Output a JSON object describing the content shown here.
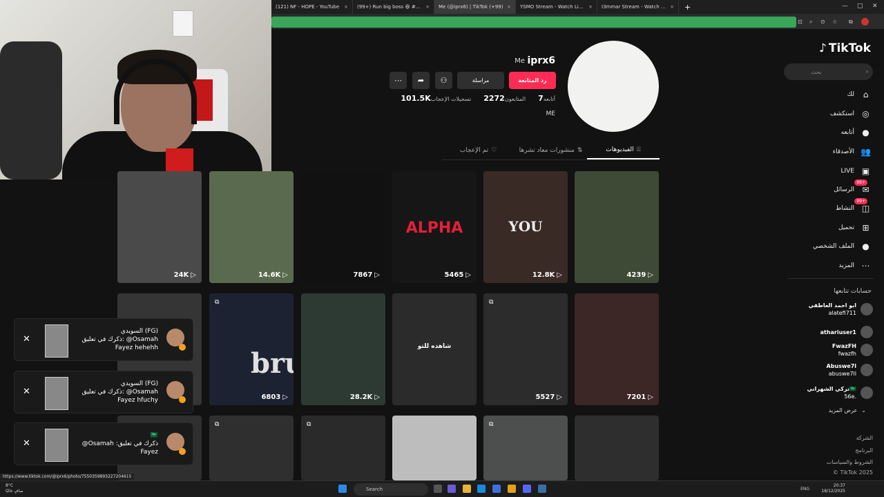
{
  "browser": {
    "tabs": [
      {
        "label": "(121) NF - HOPE - YouTube",
        "active": false
      },
      {
        "label": "(99+) Run big boss 😆 #bigboss",
        "active": false
      },
      {
        "label": "Me (@iprx6) | TikTok (+99)",
        "active": true
      },
      {
        "label": "YSMO Stream - Watch Live on",
        "active": false
      },
      {
        "label": "I3mmar Stream - Watch Live on",
        "active": false
      }
    ],
    "new_tab": "+",
    "close": "×"
  },
  "nav": {
    "logo": "TikTok",
    "search_placeholder": "بحث",
    "items": [
      {
        "label": "لك",
        "icon": "home-icon",
        "glyph": "⌂"
      },
      {
        "label": "استكشف",
        "icon": "compass-icon",
        "glyph": "◎"
      },
      {
        "label": "أتابعه",
        "icon": "following-avatar-icon",
        "glyph": "●"
      },
      {
        "label": "الأصدقاء",
        "icon": "friends-icon",
        "glyph": "👥"
      },
      {
        "label": "LIVE",
        "icon": "live-icon",
        "glyph": "▣"
      },
      {
        "label": "الرسائل",
        "icon": "messages-icon",
        "glyph": "✉",
        "badge": "99+"
      },
      {
        "label": "النشاط",
        "icon": "activity-icon",
        "glyph": "◫",
        "badge": "99+"
      },
      {
        "label": "تحميل",
        "icon": "upload-icon",
        "glyph": "⊞"
      },
      {
        "label": "الملف الشخصي",
        "icon": "profile-icon",
        "glyph": "●"
      },
      {
        "label": "المزيد",
        "icon": "more-icon",
        "glyph": "⋯"
      }
    ],
    "following_heading": "حسابات تتابعها",
    "accounts": [
      {
        "name": "ابو احمد العاطفي",
        "handle": "alatefi711"
      },
      {
        "name": "athariuser1",
        "handle": ""
      },
      {
        "name": "FwazFH",
        "handle": "fwazfh"
      },
      {
        "name": "Abuswe7l",
        "handle": "abuswe7ll"
      },
      {
        "name": "تركي الشهراني🇸🇦",
        "handle": "56e."
      }
    ],
    "see_more": "عرض المزيد",
    "footer": [
      "الشركة",
      "البرنامج",
      "الشروط والسياسات",
      "© TikTok 2025"
    ]
  },
  "profile": {
    "username": "iprx6",
    "nickname": "Me",
    "follow_back": "رد المتابعة",
    "message": "مراسلة",
    "stats": {
      "following_value": "7",
      "following_label": "أتابعه",
      "followers_value": "2272",
      "followers_label": "المتابعون",
      "likes_value": "101.5K",
      "likes_label": "تسجيلات الإعجاب"
    },
    "bio": "ME",
    "tabs": [
      {
        "label": "الفيديوهات",
        "icon": "grid-icon",
        "glyph": "⦙⦙⦙",
        "active": true
      },
      {
        "label": "منشورات معاد نشرها",
        "icon": "repost-icon",
        "glyph": "⇅",
        "active": false
      },
      {
        "label": "تم الإعجاب",
        "icon": "liked-icon",
        "glyph": "♡",
        "active": false
      }
    ]
  },
  "videos": {
    "row1": [
      {
        "count": "4239",
        "overlay": "",
        "bg": "#3e4a36",
        "pinned": false
      },
      {
        "count": "12.8K",
        "overlay": "YOU",
        "bg": "#3a2a26",
        "pinned": false
      },
      {
        "count": "5465",
        "overlay": "ALPHA",
        "bg": "#161616",
        "pinned": false
      },
      {
        "count": "7867",
        "overlay": "",
        "bg": "#111111",
        "pinned": false
      },
      {
        "count": "14.6K",
        "overlay": "",
        "bg": "#5a6a4f",
        "pinned": false
      },
      {
        "count": "24K",
        "overlay": "",
        "bg": "#4a4a4a",
        "pinned": false
      }
    ],
    "row2": [
      {
        "count": "7201",
        "overlay": "",
        "bg": "#3d2626",
        "pinned": false
      },
      {
        "count": "5527",
        "overlay": "",
        "bg": "#2c2c2c",
        "pinned": true
      },
      {
        "count": "",
        "overlay": "شاهده للتو",
        "bg": "#2b2b2b",
        "pinned": false
      },
      {
        "count": "28.2K",
        "overlay": "",
        "bg": "#2c3a33",
        "pinned": false
      },
      {
        "count": "6803",
        "overlay": "bru",
        "bg": "#1d2233",
        "pinned": true
      },
      {
        "count": "",
        "overlay": "",
        "bg": "#353535",
        "pinned": false
      }
    ],
    "row3": [
      {
        "count": "",
        "overlay": "",
        "bg": "#2e2e2e",
        "pinned": false
      },
      {
        "count": "",
        "overlay": "",
        "bg": "#4d4f4f",
        "pinned": true
      },
      {
        "count": "",
        "overlay": "",
        "bg": "#bdbdbd",
        "pinned": false
      },
      {
        "count": "",
        "overlay": "",
        "bg": "#2a2a2a",
        "pinned": true
      },
      {
        "count": "",
        "overlay": "",
        "bg": "#2f2f2f",
        "pinned": true
      },
      {
        "count": "",
        "overlay": "",
        "bg": "#2f2f2f",
        "pinned": false
      }
    ]
  },
  "notifications": [
    {
      "title": "السويدي (FG)",
      "line1": "ذكرك في تعليق: @Osamah",
      "line2": "Fayez hehehh"
    },
    {
      "title": "السويدي (FG)",
      "line1": "ذكرك في تعليق: @Osamah",
      "line2": "Fayez hfuchy"
    },
    {
      "title": "🇸🇦",
      "line1": "@Osamah :ذكرك في تعليق",
      "line2": "Fayez"
    }
  ],
  "status_url": "https://www.tiktok.com/@iprx6/photo/7550359893227204615",
  "taskbar": {
    "weather_temp": "8°C",
    "weather_desc": "صافٍ غالبًا",
    "search": "Search",
    "lang": "ENG",
    "time": "20:37",
    "date": "18/12/2025"
  },
  "colors": {
    "accent": "#fe2c55",
    "bg": "#121212"
  }
}
